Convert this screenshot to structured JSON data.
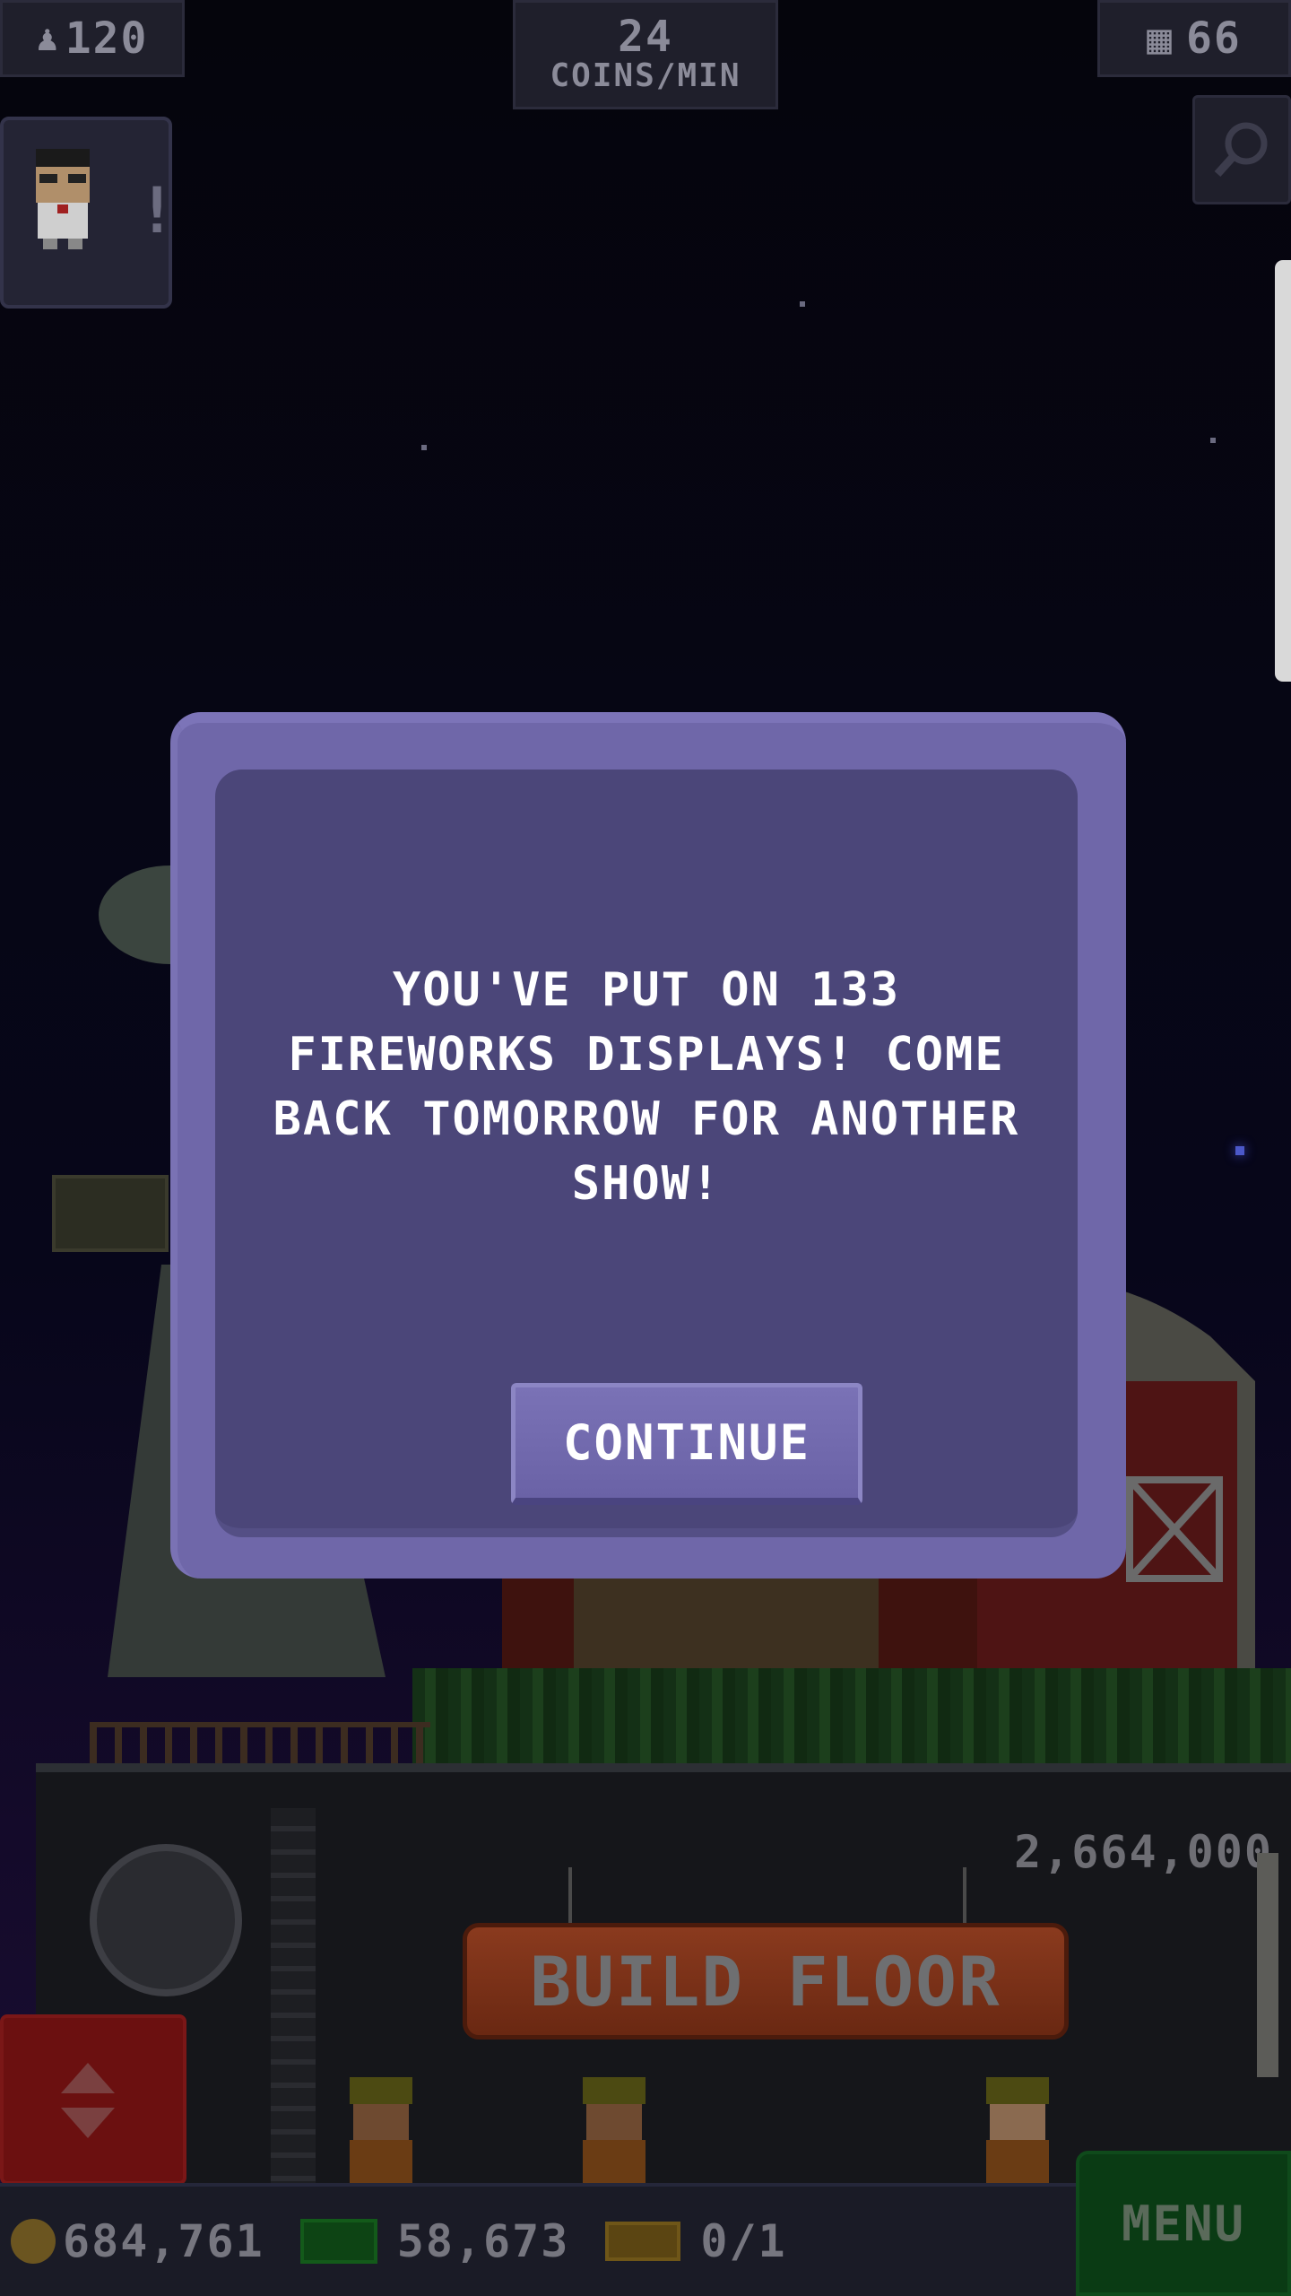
{
  "hud": {
    "population": "120",
    "coins_rate_value": "24",
    "coins_rate_unit": "COINS/MIN",
    "floors": "66"
  },
  "floor": {
    "cost": "2,664,000",
    "build_label": "BUILD FLOOR"
  },
  "bottom_bar": {
    "coins": "684,761",
    "bux": "58,673",
    "tickets": "0/1",
    "menu_label": "MENU"
  },
  "dialog": {
    "message": "YOU'VE PUT ON 133 FIREWORKS DISPLAYS! COME BACK TOMORROW FOR ANOTHER SHOW!",
    "continue_label": "CONTINUE"
  },
  "colors": {
    "dialog_outer": "#6f67a9",
    "dialog_inner": "#4b4679",
    "build_button": "#8a3a1e",
    "menu_button": "#0a3b14",
    "elevator_button": "#6b1010"
  },
  "icons": {
    "population": "person-icon",
    "floors": "building-icon",
    "search": "magnifier-icon",
    "coins": "coin-icon",
    "bux": "bux-icon",
    "tickets": "ticket-icon",
    "elevator_toggle": "up-down-arrows-icon"
  }
}
